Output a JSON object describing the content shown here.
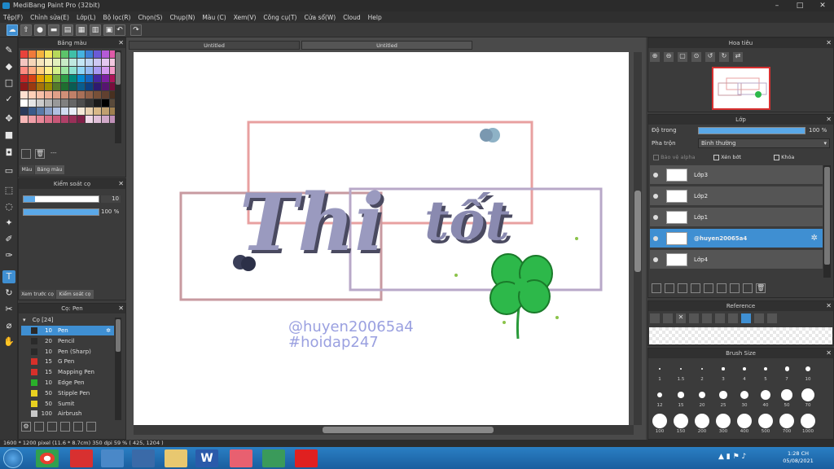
{
  "window": {
    "title": "MediBang Paint Pro (32bit)",
    "controls": [
      "–",
      "□",
      "✕"
    ]
  },
  "menu": [
    "Tệp(F)",
    "Chỉnh sửa(E)",
    "Lớp(L)",
    "Bộ lọc(R)",
    "Chọn(S)",
    "Chụp(N)",
    "Màu (C)",
    "Xem(V)",
    "Công cụ(T)",
    "Cửa sổ(W)",
    "Cloud",
    "Help"
  ],
  "canvas_tabs": [
    "Untitled",
    "Untitled"
  ],
  "color_panel": {
    "title": "Bảng màu",
    "tabs": [
      "Màu",
      "Bảng màu"
    ],
    "swatches": [
      "#e8423c",
      "#f07a3a",
      "#f5b33e",
      "#f6e35a",
      "#b7d85a",
      "#5cc46a",
      "#3fbfa8",
      "#45b3e0",
      "#3d7fd6",
      "#6a5ad6",
      "#b55ad6",
      "#e05aa8",
      "#f4c6c0",
      "#f6d6b8",
      "#f8e6bc",
      "#faf2c4",
      "#e2efbc",
      "#c8ebc6",
      "#bfe9e0",
      "#c3e6f4",
      "#c0d6f2",
      "#cdc8f2",
      "#e4c8f0",
      "#f4c8e0",
      "#ff8a80",
      "#ffab82",
      "#ffd082",
      "#fff08a",
      "#d4f08a",
      "#9ae6a0",
      "#8ee2d0",
      "#90d6f6",
      "#90b8f2",
      "#a89af2",
      "#d49af0",
      "#f49ac8",
      "#c62828",
      "#d84315",
      "#e6a100",
      "#d4c200",
      "#7cb342",
      "#2e9e46",
      "#00897b",
      "#0288d1",
      "#1565c0",
      "#4527a0",
      "#7b1fa2",
      "#ad1457",
      "#8e1a1a",
      "#9a3a10",
      "#a6720a",
      "#998c00",
      "#557a2a",
      "#1f6e30",
      "#0a5c52",
      "#0a5c8c",
      "#0d3f80",
      "#2e1a70",
      "#561570",
      "#780d3c",
      "#ffe0d0",
      "#ffd0b8",
      "#f8c0a8",
      "#f0b098",
      "#e0a088",
      "#d09078",
      "#c08068",
      "#a87058",
      "#906048",
      "#785038",
      "#604030",
      "#483020",
      "#ffffff",
      "#e6e6e6",
      "#cccccc",
      "#b3b3b3",
      "#999999",
      "#808080",
      "#666666",
      "#4d4d4d",
      "#333333",
      "#1a1a1a",
      "#000000",
      "#5a4a3a",
      "#2a3a5a",
      "#3a5a8a",
      "#5a7aa8",
      "#8aa0c8",
      "#b0c0e0",
      "#d0dcf0",
      "#e8eef8",
      "#f4e8d8",
      "#e8d0b0",
      "#d8b888",
      "#c0a070",
      "#a08050",
      "#f8b8b8",
      "#f0a0a8",
      "#e88898",
      "#d87088",
      "#c85878",
      "#b04068",
      "#983058",
      "#802048",
      "#f0d8e8",
      "#e0c0d8",
      "#d0a8c8",
      "#c090b8"
    ],
    "dash": "---"
  },
  "brush_control": {
    "title": "Kiểm soát cọ",
    "size_value": "10",
    "size_fraction": 0.15,
    "opacity_value": "100 %",
    "opacity_fraction": 1.0,
    "tabs": [
      "Xem trước cọ",
      "Kiểm soát cọ"
    ]
  },
  "brush_panel": {
    "title": "Cọ: Pen",
    "group": "Cọ [24]",
    "items": [
      {
        "size": "10",
        "name": "Pen",
        "color": "#2a2a2a",
        "selected": true
      },
      {
        "size": "20",
        "name": "Pencil",
        "color": "#2a2a2a",
        "selected": false
      },
      {
        "size": "10",
        "name": "Pen (Sharp)",
        "color": "#2a2a2a",
        "selected": false
      },
      {
        "size": "15",
        "name": "G Pen",
        "color": "#d8302a",
        "selected": false
      },
      {
        "size": "15",
        "name": "Mapping Pen",
        "color": "#d8302a",
        "selected": false
      },
      {
        "size": "10",
        "name": "Edge Pen",
        "color": "#2ab02a",
        "selected": false
      },
      {
        "size": "50",
        "name": "Stipple Pen",
        "color": "#e8d020",
        "selected": false
      },
      {
        "size": "50",
        "name": "Sumit",
        "color": "#e8d020",
        "selected": false
      },
      {
        "size": "100",
        "name": "Airbrush",
        "color": "#c8c8c8",
        "selected": false
      }
    ]
  },
  "canvas": {
    "title_text": "Thi",
    "title_text2": "tốt",
    "dot": ".",
    "signature1": "@huyen20065a4",
    "signature2": "#hoidap247"
  },
  "navigator": {
    "title": "Hoa tiêu"
  },
  "layers_panel": {
    "title": "Lớp",
    "opacity_label": "Độ trong",
    "opacity_value": "100 %",
    "opacity_fraction": 1.0,
    "blend_label": "Pha trộn",
    "blend_value": "Bình thường",
    "protect_alpha": "Bảo vệ alpha",
    "clipping": "Xén bớt",
    "lock": "Khóa",
    "layers": [
      {
        "name": "Lớp3",
        "selected": false
      },
      {
        "name": "Lớp2",
        "selected": false
      },
      {
        "name": "Lớp1",
        "selected": false
      },
      {
        "name": "@huyen20065a4",
        "selected": true
      },
      {
        "name": "Lớp4",
        "selected": false
      }
    ]
  },
  "reference": {
    "title": "Reference"
  },
  "brush_size": {
    "title": "Brush Size",
    "sizes": [
      "1",
      "1.5",
      "2",
      "3",
      "4",
      "5",
      "7",
      "10",
      "12",
      "15",
      "20",
      "25",
      "30",
      "40",
      "50",
      "70",
      "100",
      "150",
      "200",
      "300",
      "400",
      "500",
      "700",
      "1000"
    ]
  },
  "status": {
    "text": "1600 * 1200 pixel   (11.6 * 8.7cm)   350 dpi   59 %   ( 425, 1204 )"
  },
  "taskbar": {
    "time": "1:28 CH",
    "date": "05/08/2021"
  },
  "colors": {
    "accent": "#3f8fd2",
    "clover": "#2db84a",
    "lettering": "#9a9abf",
    "frame_pink": "#e8a0a0",
    "frame_gray": "#9090a8"
  }
}
